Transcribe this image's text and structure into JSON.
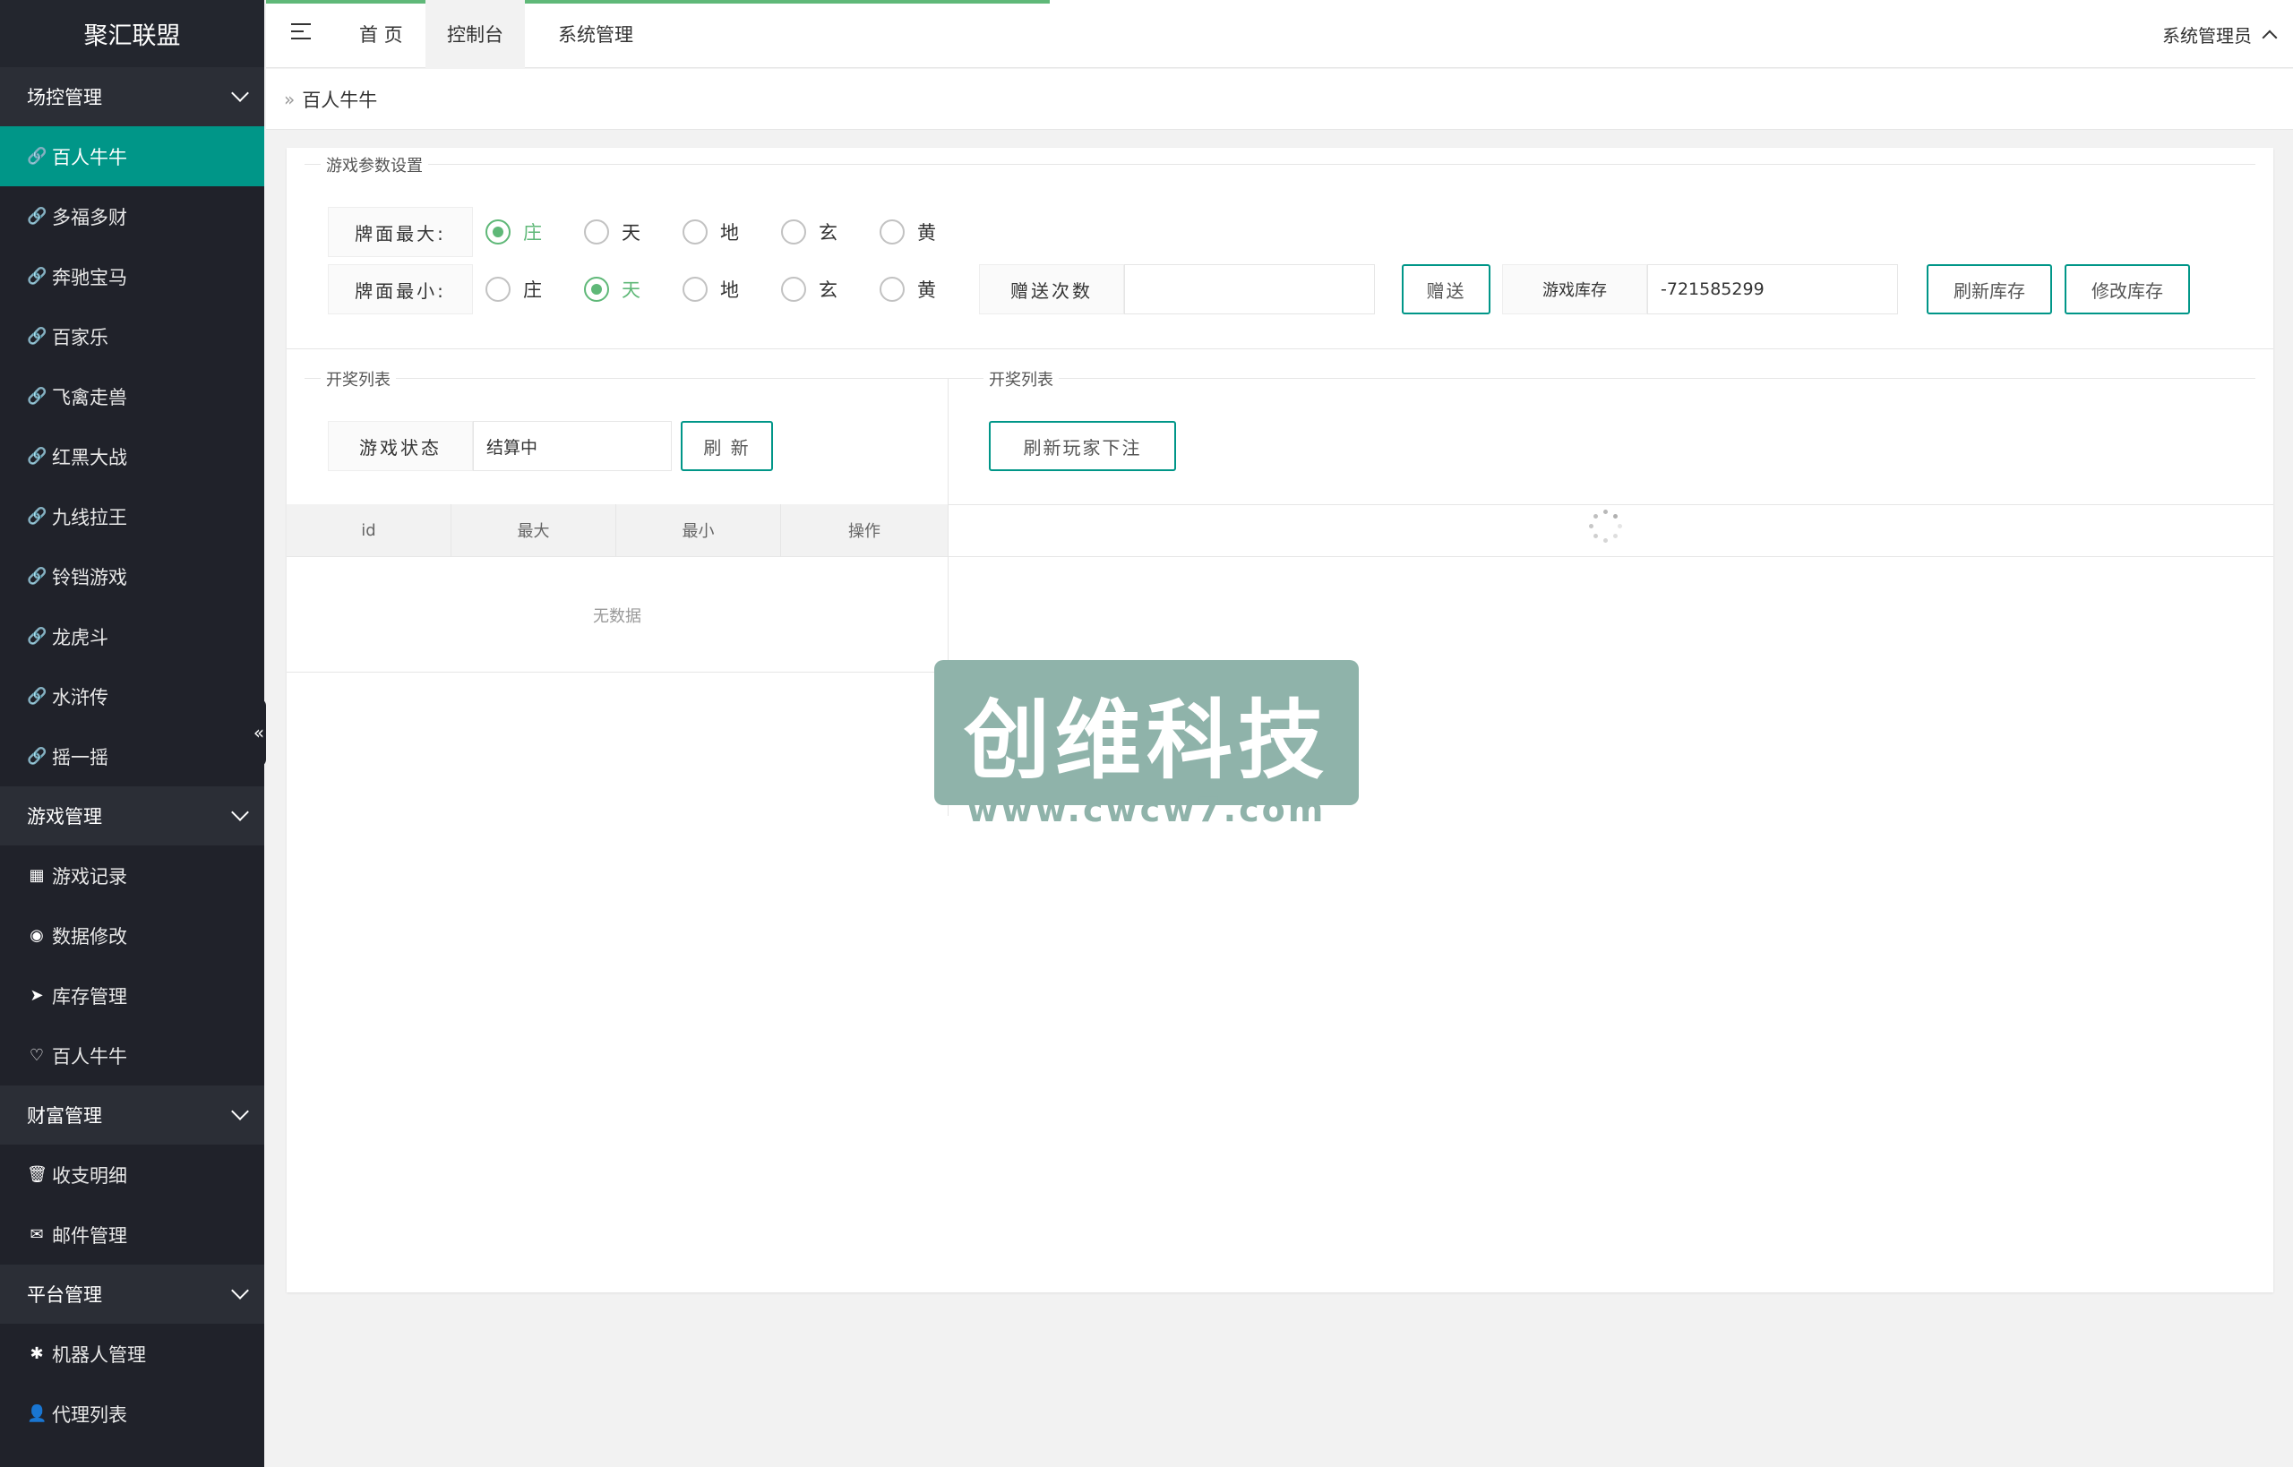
{
  "app": {
    "title": "聚汇联盟",
    "accent": "#009688",
    "radio_color": "#5fb878"
  },
  "header": {
    "nav": [
      "首 页",
      "控制台",
      "系统管理"
    ],
    "active_nav": "控制台",
    "user": "系统管理员"
  },
  "sidebar": {
    "groups": [
      {
        "label": "场控管理",
        "items": [
          {
            "icon": "link-icon",
            "label": "百人牛牛",
            "active": true
          },
          {
            "icon": "link-icon",
            "label": "多福多财"
          },
          {
            "icon": "link-icon",
            "label": "奔驰宝马"
          },
          {
            "icon": "link-icon",
            "label": "百家乐"
          },
          {
            "icon": "link-icon",
            "label": "飞禽走兽"
          },
          {
            "icon": "link-icon",
            "label": "红黑大战"
          },
          {
            "icon": "link-icon",
            "label": "九线拉王"
          },
          {
            "icon": "link-icon",
            "label": "铃铛游戏"
          },
          {
            "icon": "link-icon",
            "label": "龙虎斗"
          },
          {
            "icon": "link-icon",
            "label": "水浒传"
          },
          {
            "icon": "link-icon",
            "label": "摇一摇"
          }
        ]
      },
      {
        "label": "游戏管理",
        "items": [
          {
            "icon": "table-icon",
            "label": "游戏记录"
          },
          {
            "icon": "broadcast-icon",
            "label": "数据修改"
          },
          {
            "icon": "send-icon",
            "label": "库存管理"
          },
          {
            "icon": "heart-icon",
            "label": "百人牛牛"
          }
        ]
      },
      {
        "label": "财富管理",
        "items": [
          {
            "icon": "trash-icon",
            "label": "收支明细"
          },
          {
            "icon": "mail-icon",
            "label": "邮件管理"
          }
        ]
      },
      {
        "label": "平台管理",
        "items": [
          {
            "icon": "android-icon",
            "label": "机器人管理"
          },
          {
            "icon": "user-icon",
            "label": "代理列表"
          }
        ]
      }
    ]
  },
  "breadcrumb": {
    "current": "百人牛牛"
  },
  "params": {
    "legend": "游戏参数设置",
    "max_label": "牌面最大:",
    "min_label": "牌面最小:",
    "options": [
      "庄",
      "天",
      "地",
      "玄",
      "黄"
    ],
    "max_selected": "庄",
    "min_selected": "天",
    "gift_label": "赠送次数",
    "gift_value": "",
    "gift_button": "赠送",
    "stock_label": "游戏库存",
    "stock_value": "-721585299",
    "refresh_stock_button": "刷新库存",
    "modify_stock_button": "修改库存"
  },
  "draw_list_left": {
    "legend": "开奖列表",
    "status_label": "游戏状态",
    "status_value": "结算中",
    "refresh_button": "刷 新",
    "columns": [
      "id",
      "最大",
      "最小",
      "操作"
    ],
    "empty_text": "无数据"
  },
  "draw_list_right": {
    "legend": "开奖列表",
    "refresh_bets_button": "刷新玩家下注"
  },
  "watermark": {
    "text": "创维科技",
    "url": "www.cwcw7.com"
  }
}
